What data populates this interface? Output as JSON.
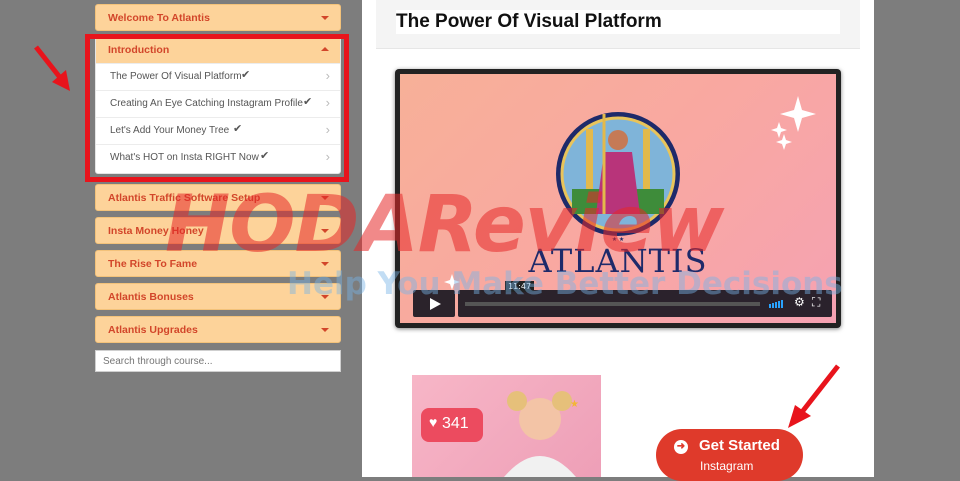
{
  "sidebar": {
    "sections": [
      {
        "label": "Welcome To Atlantis"
      },
      {
        "label": "Introduction"
      },
      {
        "label": "Atlantis Traffic Software Setup"
      },
      {
        "label": "Insta Money Honey"
      },
      {
        "label": "The Rise To Fame"
      },
      {
        "label": "Atlantis Bonuses"
      },
      {
        "label": "Atlantis Upgrades"
      }
    ],
    "lessons": [
      {
        "label": "The Power Of Visual Platform",
        "completed": true
      },
      {
        "label": "Creating An Eye Catching Instagram Profile",
        "completed": true
      },
      {
        "label": "Let's Add Your Money Tree",
        "completed": true
      },
      {
        "label": "What's HOT on Insta RIGHT Now",
        "completed": true
      }
    ],
    "search_placeholder": "Search through course..."
  },
  "main": {
    "title": "The Power Of Visual Platform",
    "video": {
      "brand": "ATLANTIS",
      "time": "11:47"
    },
    "promo": {
      "likes": "341"
    },
    "cta": {
      "label": "Get Started",
      "sub": "Instagram"
    }
  },
  "watermark": {
    "big": "HODAReview",
    "small": "Help You Make Better Decisions"
  },
  "colors": {
    "accordion_bg": "#fdd39a",
    "accordion_text": "#d2462a",
    "highlight": "#e8141c",
    "cta": "#df3a2b",
    "page_bg": "#7d7d7d"
  }
}
